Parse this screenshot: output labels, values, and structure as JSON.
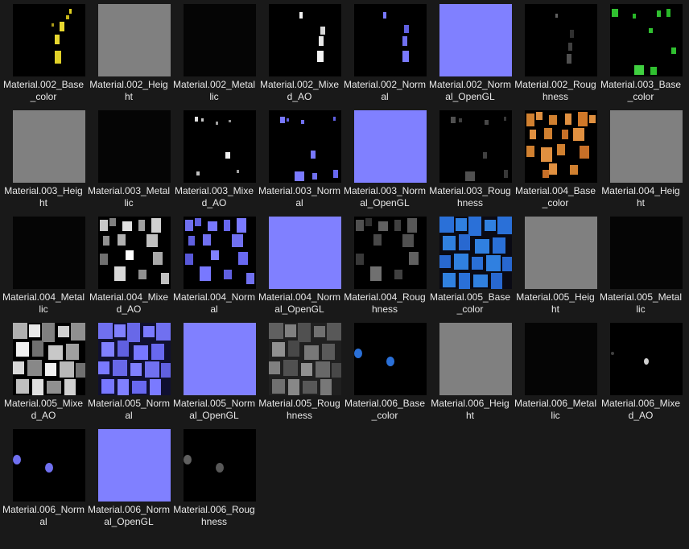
{
  "files": [
    {
      "name": "Material.002_Base_color",
      "swatch": "#000000",
      "icon": "texture-base-color-yellow"
    },
    {
      "name": "Material.002_Height",
      "swatch": "#808080",
      "icon": "texture-height-flat"
    },
    {
      "name": "Material.002_Metallic",
      "swatch": "#050505",
      "icon": "texture-metallic-flat"
    },
    {
      "name": "Material.002_Mixed_AO",
      "swatch": "#000000",
      "icon": "texture-ao-white"
    },
    {
      "name": "Material.002_Normal",
      "swatch": "#000000",
      "icon": "texture-normal-blue"
    },
    {
      "name": "Material.002_Normal_OpenGL",
      "swatch": "#8080ff",
      "icon": "texture-normal-flat"
    },
    {
      "name": "Material.002_Roughness",
      "swatch": "#000000",
      "icon": "texture-roughness-grey"
    },
    {
      "name": "Material.003_Base_color",
      "swatch": "#000000",
      "icon": "texture-base-color-green"
    },
    {
      "name": "Material.003_Height",
      "swatch": "#808080",
      "icon": "texture-height-flat"
    },
    {
      "name": "Material.003_Metallic",
      "swatch": "#050505",
      "icon": "texture-metallic-flat"
    },
    {
      "name": "Material.003_Mixed_AO",
      "swatch": "#000000",
      "icon": "texture-ao-white"
    },
    {
      "name": "Material.003_Normal",
      "swatch": "#000000",
      "icon": "texture-normal-blue"
    },
    {
      "name": "Material.003_Normal_OpenGL",
      "swatch": "#8080ff",
      "icon": "texture-normal-flat"
    },
    {
      "name": "Material.003_Roughness",
      "swatch": "#000000",
      "icon": "texture-roughness-grey"
    },
    {
      "name": "Material.004_Base_color",
      "swatch": "#000000",
      "icon": "texture-base-color-orange"
    },
    {
      "name": "Material.004_Height",
      "swatch": "#808080",
      "icon": "texture-height-flat"
    },
    {
      "name": "Material.004_Metallic",
      "swatch": "#050505",
      "icon": "texture-metallic-flat"
    },
    {
      "name": "Material.004_Mixed_AO",
      "swatch": "#000000",
      "icon": "texture-ao-dense"
    },
    {
      "name": "Material.004_Normal",
      "swatch": "#000000",
      "icon": "texture-normal-blue"
    },
    {
      "name": "Material.004_Normal_OpenGL",
      "swatch": "#8080ff",
      "icon": "texture-normal-flat"
    },
    {
      "name": "Material.004_Roughness",
      "swatch": "#000000",
      "icon": "texture-roughness-grey"
    },
    {
      "name": "Material.005_Base_color",
      "swatch": "#000000",
      "icon": "texture-base-color-blue"
    },
    {
      "name": "Material.005_Height",
      "swatch": "#808080",
      "icon": "texture-height-flat"
    },
    {
      "name": "Material.005_Metallic",
      "swatch": "#050505",
      "icon": "texture-metallic-flat"
    },
    {
      "name": "Material.005_Mixed_AO",
      "swatch": "#000000",
      "icon": "texture-ao-dense"
    },
    {
      "name": "Material.005_Normal",
      "swatch": "#000000",
      "icon": "texture-normal-blue"
    },
    {
      "name": "Material.005_Normal_OpenGL",
      "swatch": "#8080ff",
      "icon": "texture-normal-flat"
    },
    {
      "name": "Material.005_Roughness",
      "swatch": "#000000",
      "icon": "texture-roughness-grey"
    },
    {
      "name": "Material.006_Base_color",
      "swatch": "#000000",
      "icon": "texture-base-color-blue"
    },
    {
      "name": "Material.006_Height",
      "swatch": "#808080",
      "icon": "texture-height-flat"
    },
    {
      "name": "Material.006_Metallic",
      "swatch": "#050505",
      "icon": "texture-metallic-flat"
    },
    {
      "name": "Material.006_Mixed_AO",
      "swatch": "#000000",
      "icon": "texture-ao-white"
    },
    {
      "name": "Material.006_Normal",
      "swatch": "#000000",
      "icon": "texture-normal-blue"
    },
    {
      "name": "Material.006_Normal_OpenGL",
      "swatch": "#8080ff",
      "icon": "texture-normal-flat"
    },
    {
      "name": "Material.006_Roughness",
      "swatch": "#000000",
      "icon": "texture-roughness-grey"
    }
  ]
}
